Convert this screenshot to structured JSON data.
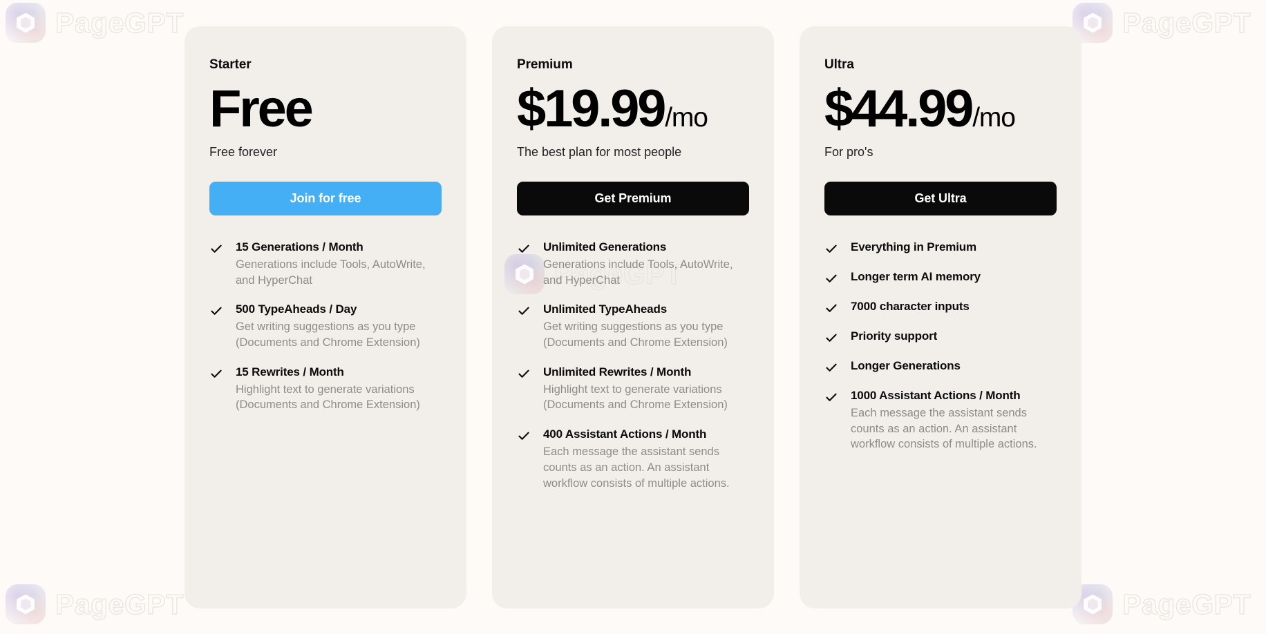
{
  "brand": {
    "watermark_text": "PageGPT",
    "logo_icon": "hexagon-logo-icon"
  },
  "colors": {
    "page_background": "#fdfaf7",
    "card_background": "#f2efeb",
    "primary_blue": "#45AFF5",
    "primary_black": "#0a0a0a",
    "title_text": "#0b0b0c",
    "muted_text": "#8e8b88"
  },
  "plans": [
    {
      "name": "Starter",
      "price_main": "Free",
      "price_period": "",
      "tagline": "Free forever",
      "cta_label": "Join for free",
      "cta_style": "blue",
      "features": [
        {
          "title": "15 Generations / Month",
          "desc": "Generations include Tools, AutoWrite, and HyperChat"
        },
        {
          "title": "500 TypeAheads / Day",
          "desc": "Get writing suggestions as you type (Documents and Chrome Extension)"
        },
        {
          "title": "15 Rewrites / Month",
          "desc": "Highlight text to generate variations (Documents and Chrome Extension)"
        }
      ]
    },
    {
      "name": "Premium",
      "price_main": "$19.99",
      "price_period": "/mo",
      "tagline": "The best plan for most people",
      "cta_label": "Get Premium",
      "cta_style": "black",
      "features": [
        {
          "title": "Unlimited Generations",
          "desc": "Generations include Tools, AutoWrite, and HyperChat"
        },
        {
          "title": "Unlimited TypeAheads",
          "desc": "Get writing suggestions as you type (Documents and Chrome Extension)"
        },
        {
          "title": "Unlimited Rewrites / Month",
          "desc": "Highlight text to generate variations (Documents and Chrome Extension)"
        },
        {
          "title": "400 Assistant Actions / Month",
          "desc": "Each message the assistant sends counts as an action. An assistant workflow consists of multiple actions."
        }
      ]
    },
    {
      "name": "Ultra",
      "price_main": "$44.99",
      "price_period": "/mo",
      "tagline": "For pro's",
      "cta_label": "Get Ultra",
      "cta_style": "black",
      "features": [
        {
          "title": "Everything in Premium",
          "desc": ""
        },
        {
          "title": "Longer term AI memory",
          "desc": ""
        },
        {
          "title": "7000 character inputs",
          "desc": ""
        },
        {
          "title": "Priority support",
          "desc": ""
        },
        {
          "title": "Longer Generations",
          "desc": ""
        },
        {
          "title": "1000 Assistant Actions / Month",
          "desc": "Each message the assistant sends counts as an action. An assistant workflow consists of multiple actions."
        }
      ]
    }
  ]
}
